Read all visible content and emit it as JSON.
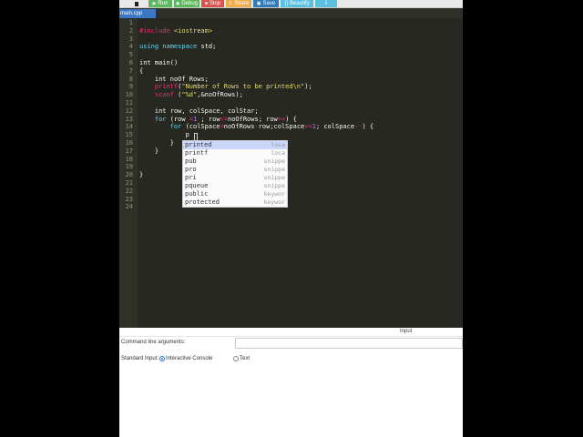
{
  "toolbar": {
    "run": "Run",
    "debug": "Debug",
    "stop": "Stop",
    "share": "Share",
    "save": "Save",
    "beautify": "{} Beautify",
    "download_icon": "⇩"
  },
  "file_tab": "main.cpp",
  "line_numbers": [
    "1",
    "2",
    "3",
    "4",
    "5",
    "6",
    "7",
    "8",
    "9",
    "10",
    "11",
    "12",
    "13",
    "14",
    "15",
    "16",
    "17",
    "18",
    "19",
    "20",
    "21",
    "22",
    "23",
    "24"
  ],
  "code": {
    "l2_pp": "#include",
    "l2_hdr": " <iostream>",
    "l4_kw1": "using",
    "l4_kw2": " namespace",
    "l4_rest": " std;",
    "l6_kw": "int",
    "l6_rest": " main()",
    "l7": "{",
    "l8_kw": "    int",
    "l8_rest": " noOf Rows;",
    "l9_fn": "    printf",
    "l9_open": "(",
    "l9_str": "\"Number of Rows to be printed\\n\"",
    "l9_close": ");",
    "l10_fn": "    scanf",
    "l10_open": " (",
    "l10_str": "\"%d\"",
    "l10_close": ",&noOfRows);",
    "l12_kw": "    int",
    "l12_rest": " row, colSpace, colStar;",
    "l13_kw": "    for",
    "l13_a": " (row ",
    "l13_op1": "=",
    "l13_num": "1",
    "l13_b": " ; row",
    "l13_op2": "<=",
    "l13_c": "noOfRows; row",
    "l13_op3": "++",
    "l13_d": ") {",
    "l14_kw": "        for",
    "l14_a": " (colSpace",
    "l14_op1": "=",
    "l14_b": "noOfRows",
    "l14_op2": "-",
    "l14_c": "row;colSpace",
    "l14_op3": ">=",
    "l14_num": "1",
    "l14_d": "; colSpace",
    "l14_op4": "--",
    "l14_e": ") {",
    "l15": "            p",
    "l16": "        }",
    "l17": "    }",
    "l20": "}"
  },
  "autocomplete": [
    {
      "name": "printed",
      "meta": "loca"
    },
    {
      "name": "printf",
      "meta": "loca"
    },
    {
      "name": "pub",
      "meta": "snippe"
    },
    {
      "name": "pro",
      "meta": "snippe"
    },
    {
      "name": "pri",
      "meta": "snippe"
    },
    {
      "name": "pqueue",
      "meta": "snippe"
    },
    {
      "name": "public",
      "meta": "keywor"
    },
    {
      "name": "protected",
      "meta": "keywor"
    }
  ],
  "io": {
    "input_label": "Input",
    "cmd_label": "Command line arguments:",
    "cmd_value": "",
    "stdin_label": "Standard Input:",
    "option_interactive": "Interactive Console",
    "option_text": "Text",
    "selected": "Interactive Console"
  }
}
